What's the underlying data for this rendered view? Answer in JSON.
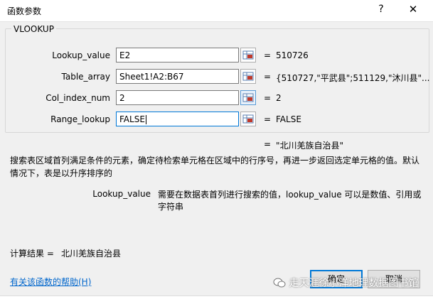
{
  "window": {
    "title": "函数参数",
    "help": "?",
    "close": "✕"
  },
  "function_name": "VLOOKUP",
  "args": [
    {
      "label": "Lookup_value",
      "input": "E2",
      "eq": "=",
      "value": "510726"
    },
    {
      "label": "Table_array",
      "input": "Sheet1!A2:B67",
      "eq": "=",
      "value": "{510727,\"平武县\";511129,\"沐川县\"..."
    },
    {
      "label": "Col_index_num",
      "input": "2",
      "eq": "=",
      "value": "2"
    },
    {
      "label": "Range_lookup",
      "input": "FALSE",
      "eq": "=",
      "value": "FALSE"
    }
  ],
  "result": {
    "eq": "=",
    "value": "\"北川羌族自治县\""
  },
  "description": "搜索表区域首列满足条件的元素，确定待检索单元格在区域中的行序号，再进一步返回选定单元格的值。默认情况下，表是以升序排序的",
  "arg_help": {
    "name": "Lookup_value",
    "text": "需要在数据表首列进行搜索的值，lookup_value 可以是数值、引用或字符串"
  },
  "calc": {
    "label": "计算结果 =",
    "value": "北川羌族自治县"
  },
  "help_link": "有关该函数的帮助(H)",
  "buttons": {
    "ok": "确定",
    "cancel": "取消"
  },
  "watermark": "走天涯徐小洋地理数据图书馆"
}
